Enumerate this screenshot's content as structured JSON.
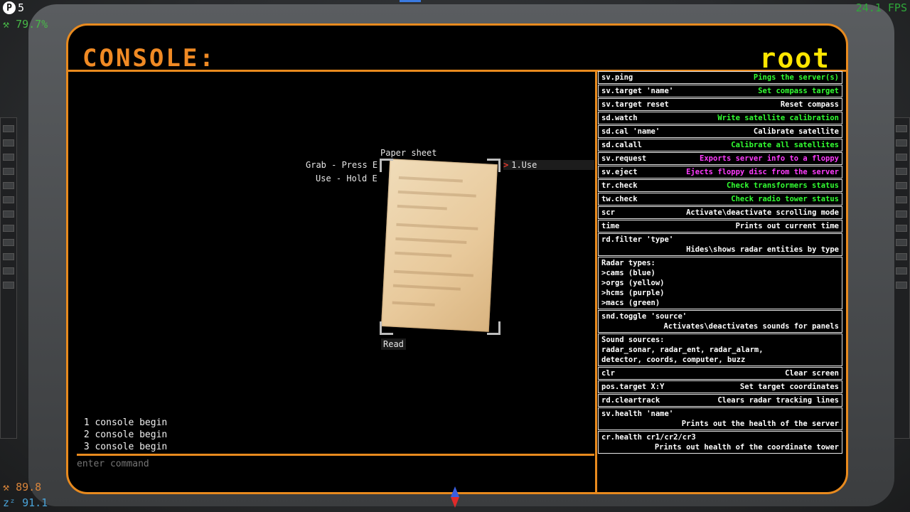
{
  "hud": {
    "badge_letter": "P",
    "count": "5",
    "percent": "79.7%",
    "fps": "24.1 FPS",
    "stat_orange": "89.8",
    "stat_blue": "91.1"
  },
  "console": {
    "title": "CONSOLE:",
    "user": "root",
    "log": [
      " 1 console begin",
      " 2 console begin",
      " 3 console begin"
    ],
    "input_placeholder": "enter command"
  },
  "prompt": {
    "object_name": "Paper sheet",
    "grab": "Grab - Press E",
    "use_hold": "Use - Hold E",
    "option": "1.Use",
    "read": "Read"
  },
  "help": [
    {
      "cmd": "sv.ping",
      "desc": "Pings the server(s)",
      "color": "green"
    },
    {
      "cmd": "sv.target 'name'",
      "desc": "Set compass target",
      "color": "green"
    },
    {
      "cmd": "sv.target reset",
      "desc": "Reset compass",
      "color": "white"
    },
    {
      "cmd": "sd.watch",
      "desc": "Write satellite calibration",
      "color": "green"
    },
    {
      "cmd": "sd.cal 'name'",
      "desc": "Calibrate satellite",
      "color": "white"
    },
    {
      "cmd": "sd.calall",
      "desc": "Calibrate all satellites",
      "color": "green"
    },
    {
      "cmd": "sv.request",
      "desc": "Exports server info to a floppy",
      "color": "magenta"
    },
    {
      "cmd": "sv.eject",
      "desc": "Ejects floppy disc from the server",
      "color": "magenta"
    },
    {
      "cmd": "tr.check",
      "desc": "Check transformers status",
      "color": "green"
    },
    {
      "cmd": "tw.check",
      "desc": "Check radio tower status",
      "color": "green"
    },
    {
      "cmd": "scr",
      "desc": "Activate\\deactivate scrolling mode",
      "color": "white"
    },
    {
      "cmd": "time",
      "desc": "Prints out current time",
      "color": "white"
    }
  ],
  "help_blocks": {
    "rd_filter": {
      "cmd": "rd.filter 'type'",
      "desc": "Hides\\shows radar entities by type"
    },
    "radar_types": {
      "title": "Radar types:",
      "items": [
        ">cams (blue)",
        ">orgs (yellow)",
        ">hcms (purple)",
        ">macs (green)"
      ]
    },
    "snd_toggle": {
      "cmd": "snd.toggle 'source'",
      "desc": "Activates\\deactivates sounds for panels"
    },
    "sound_sources": {
      "title": "Sound sources:",
      "line1": "radar_sonar, radar_ent, radar_alarm,",
      "line2": "detector, coords, computer, buzz"
    },
    "clr": {
      "cmd": "clr",
      "desc": "Clear screen"
    },
    "pos_target": {
      "cmd": "pos.target X:Y",
      "desc": "Set target coordinates"
    },
    "rd_cleartrack": {
      "cmd": "rd.cleartrack",
      "desc": "Clears radar tracking lines"
    },
    "sv_health": {
      "cmd": "sv.health 'name'",
      "desc": "Prints out the health of the server"
    },
    "cr_health": {
      "cmd": "cr.health cr1/cr2/cr3",
      "desc": "Prints out health of the coordinate tower"
    }
  },
  "colors": {
    "accent": "#e88a1e",
    "root": "#ffe600",
    "green": "#32ff32",
    "magenta": "#ff3cff"
  }
}
